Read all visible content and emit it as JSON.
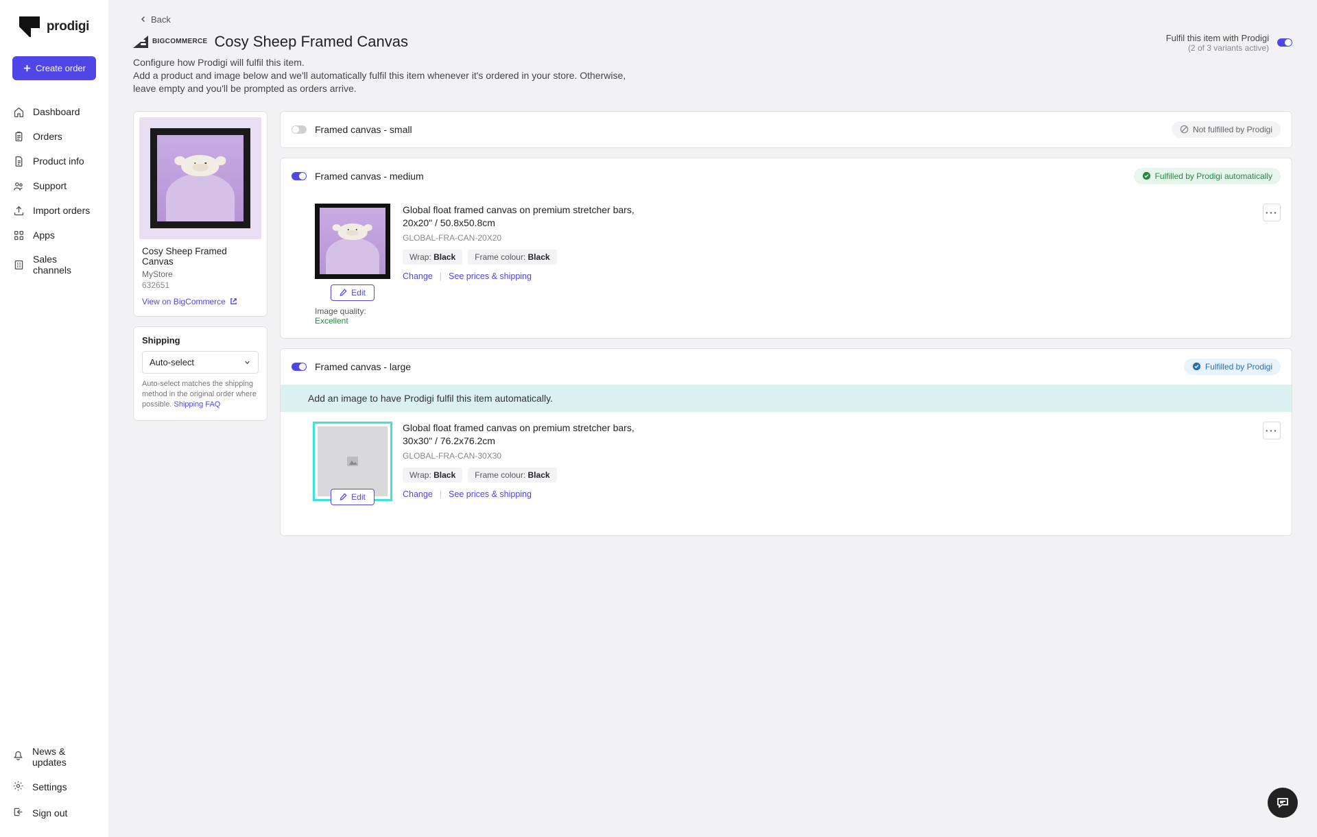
{
  "logo": "prodigi",
  "create_order": "Create order",
  "nav": [
    {
      "label": "Dashboard",
      "icon": "home"
    },
    {
      "label": "Orders",
      "icon": "clipboard"
    },
    {
      "label": "Product info",
      "icon": "file"
    },
    {
      "label": "Support",
      "icon": "users"
    },
    {
      "label": "Import orders",
      "icon": "upload"
    },
    {
      "label": "Apps",
      "icon": "grid"
    },
    {
      "label": "Sales channels",
      "icon": "building"
    }
  ],
  "nav_bottom": [
    {
      "label": "News & updates",
      "icon": "bell"
    },
    {
      "label": "Settings",
      "icon": "gear"
    },
    {
      "label": "Sign out",
      "icon": "signout"
    }
  ],
  "back": "Back",
  "platform_label": "BIGCOMMERCE",
  "page_title": "Cosy Sheep Framed Canvas",
  "subtitle": "Configure how Prodigi will fulfil this item.",
  "description": "Add a product and image below and we'll automatically fulfil this item whenever it's ordered in your store. Otherwise, leave empty and you'll be prompted as orders arrive.",
  "fulfil_toggle": {
    "label": "Fulfil this item with Prodigi",
    "sub": "(2 of 3 variants active)"
  },
  "product_card": {
    "name": "Cosy Sheep Framed Canvas",
    "store": "MyStore",
    "id": "632651",
    "view_link": "View on BigCommerce"
  },
  "shipping": {
    "title": "Shipping",
    "value": "Auto-select",
    "note": "Auto-select matches the shipping method in the original order where possible. ",
    "faq": "Shipping FAQ"
  },
  "status_labels": {
    "not": "Not fulfilled by Prodigi",
    "auto": "Fulfilled by Prodigi automatically",
    "prodigi": "Fulfilled by Prodigi"
  },
  "common": {
    "edit": "Edit",
    "change": "Change",
    "see_prices": "See prices & shipping",
    "wrap_label": "Wrap: ",
    "frame_label": "Frame colour: ",
    "image_quality_label": "Image quality: "
  },
  "variants": [
    {
      "title": "Framed canvas - small",
      "enabled": false,
      "status": "not"
    },
    {
      "title": "Framed canvas - medium",
      "enabled": true,
      "status": "auto",
      "product_title": "Global float framed canvas on premium stretcher bars, 20x20\" / 50.8x50.8cm",
      "sku": "GLOBAL-FRA-CAN-20X20",
      "wrap": "Black",
      "frame": "Black",
      "image_quality": "Excellent",
      "has_image": true
    },
    {
      "title": "Framed canvas - large",
      "enabled": true,
      "status": "prodigi",
      "banner": "Add an image to have Prodigi fulfil this item automatically.",
      "product_title": "Global float framed canvas on premium stretcher bars, 30x30\" / 76.2x76.2cm",
      "sku": "GLOBAL-FRA-CAN-30X30",
      "wrap": "Black",
      "frame": "Black",
      "has_image": false
    }
  ]
}
